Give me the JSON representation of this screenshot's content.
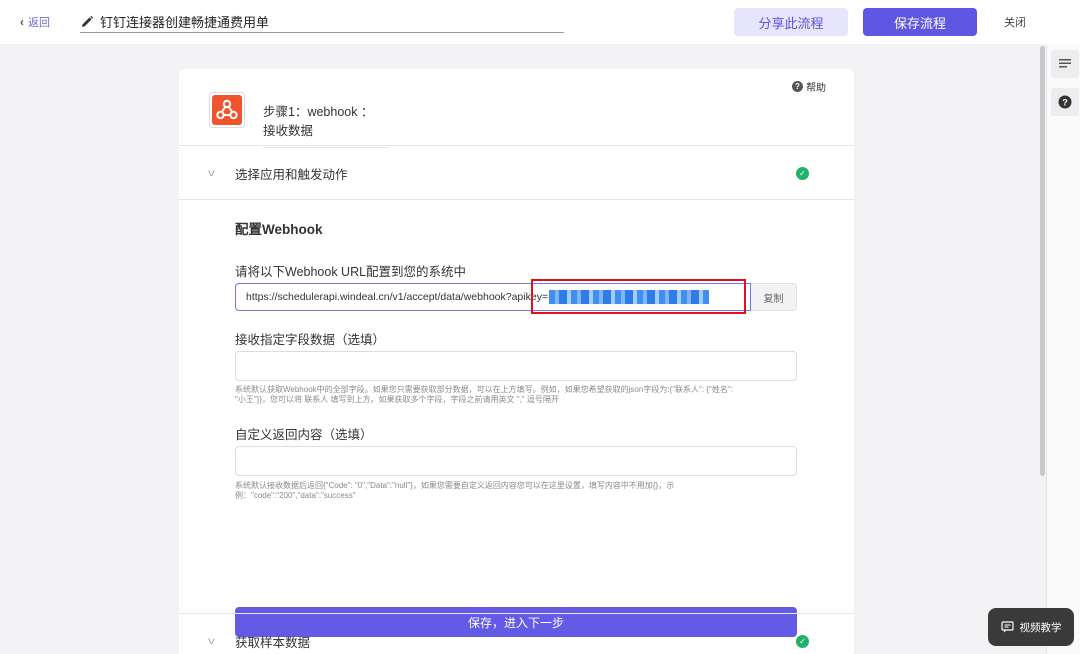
{
  "topbar": {
    "back_label": "返回",
    "title": "钉钉连接器创建畅捷通费用单",
    "share_label": "分享此流程",
    "save_label": "保存流程",
    "close_label": "关闭"
  },
  "step": {
    "help_label": "帮助",
    "title": "步骤1：webhook ： 接收数据"
  },
  "sections": {
    "select_app": "选择应用和触发动作",
    "sample_data": "获取样本数据"
  },
  "config": {
    "heading": "配置Webhook",
    "url_label": "请将以下Webhook URL配置到您的系统中",
    "url_value": "https://schedulerapi.windeal.cn/v1/accept/data/webhook?apikey=",
    "copy_label": "复制",
    "fields_label": "接收指定字段数据（选填）",
    "fields_hint_1": "系统默认获取Webhook中的全部字段。如果您只需要获取部分数据，可以在上方填写。例如，如果您希望获取的json字段为:{\"联系人\": {\"姓名\":",
    "fields_hint_2": "\"小王\"}}，您可以将 联系人 填写到上方。如果获取多个字段，字段之前请用英文 \",\" 逗号隔开",
    "return_label": "自定义返回内容（选填）",
    "return_hint_1": "系统默认接收数据后返回{\"Code\": \"0\",\"Data\":\"null\"}，如果您需要自定义返回内容您可以在这里设置，填写内容中不用加{}，示",
    "return_hint_2": "例：\"code\":\"200\",\"data\":\"success\"",
    "next_label": "保存，进入下一步"
  },
  "video": {
    "label": "视频教学"
  },
  "colors": {
    "accent": "#5f57e3",
    "success": "#20b26b",
    "highlight": "#e3101e",
    "brand_logo": "#f0542d"
  }
}
